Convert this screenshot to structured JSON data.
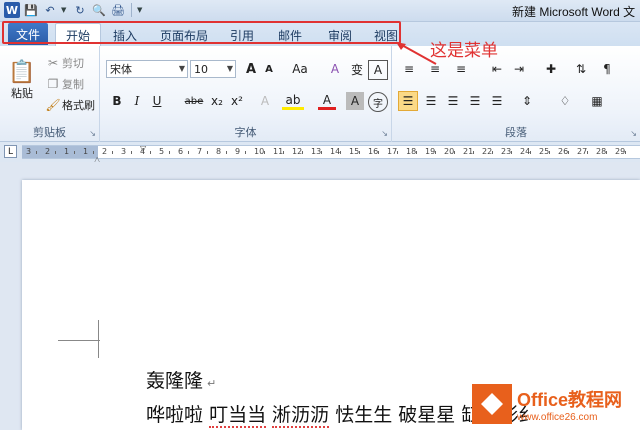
{
  "window": {
    "title": "新建 Microsoft Word 文"
  },
  "qat": {
    "logo": "W",
    "icons": [
      "save-icon",
      "undo-icon",
      "redo-icon",
      "print-preview-icon",
      "print-icon"
    ]
  },
  "tabs": {
    "file": "文件",
    "items": [
      "开始",
      "插入",
      "页面布局",
      "引用",
      "邮件",
      "审阅",
      "视图"
    ],
    "active_index": 0
  },
  "annotation": {
    "text": "这是菜单",
    "color": "#e03232"
  },
  "clipboard": {
    "label": "剪贴板",
    "paste": "粘贴",
    "cut": "剪切",
    "copy": "复制",
    "format_painter": "格式刷"
  },
  "font": {
    "label": "字体",
    "font_name": "宋体",
    "font_size": "10",
    "grow": "A",
    "shrink": "A",
    "change_case": "Aa",
    "clear_format": "A",
    "phonetic": "变",
    "border_char": "A",
    "bold": "B",
    "italic": "I",
    "underline": "U",
    "strike": "abe",
    "subscript": "x₂",
    "superscript": "x²",
    "text_effect": "A",
    "highlight": "ab",
    "font_color": "A",
    "char_shading": "A",
    "enclose": "字"
  },
  "paragraph": {
    "label": "段落"
  },
  "ruler": {
    "numbers": [
      "3",
      "2",
      "1",
      "1",
      "2",
      "3",
      "4",
      "5",
      "6",
      "7",
      "8",
      "9",
      "10",
      "11",
      "12",
      "13",
      "14",
      "15",
      "16",
      "17",
      "18",
      "19",
      "20",
      "21",
      "22",
      "23",
      "24",
      "25",
      "26",
      "27",
      "28",
      "29"
    ]
  },
  "document": {
    "line1": "轰隆隆",
    "line2_parts": [
      "哗啦啦",
      "叮当当",
      "淅沥沥",
      "怯生生",
      "破星星",
      "缸股形纟"
    ]
  },
  "watermark": {
    "title": "Office教程网",
    "url": "www.office26.com"
  },
  "colors": {
    "accent": "#2a5ca8",
    "highlight_box": "#e03232",
    "watermark": "#e8601c"
  }
}
